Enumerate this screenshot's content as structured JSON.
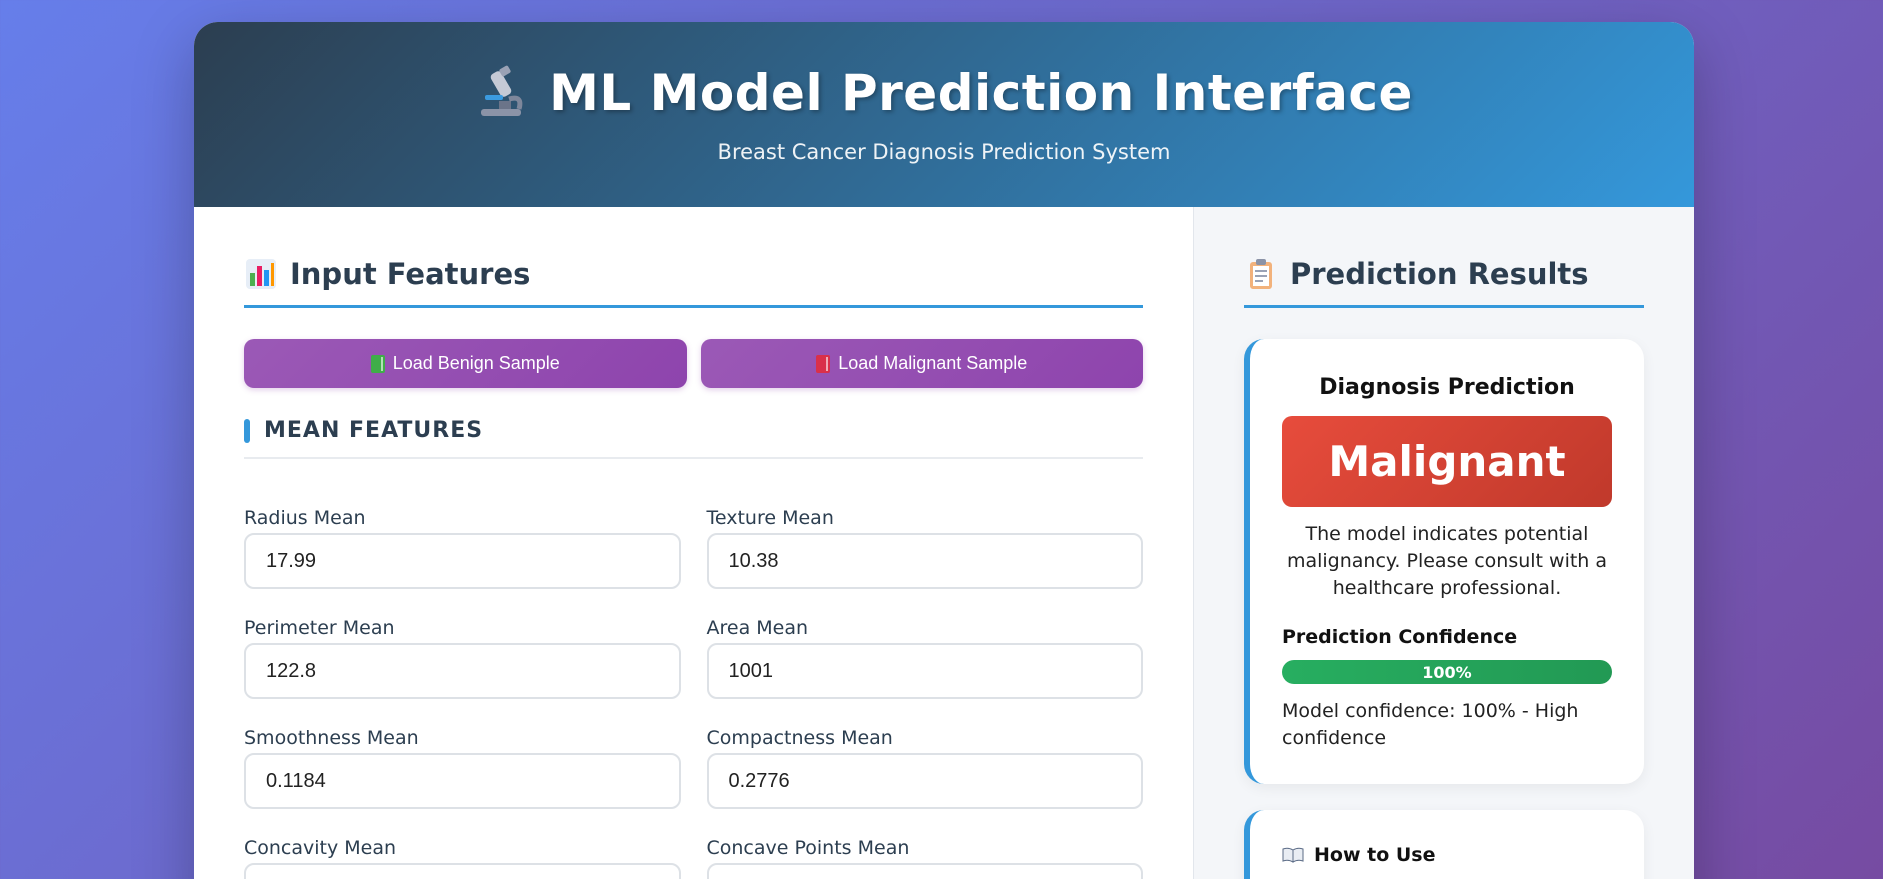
{
  "header": {
    "title": "ML Model Prediction Interface",
    "subtitle": "Breast Cancer Diagnosis Prediction System",
    "icon": "microscope-icon"
  },
  "input_panel": {
    "title": "Input Features",
    "icon": "bar-chart-icon",
    "buttons": {
      "benign": {
        "label": "Load Benign Sample",
        "icon": "green-book-icon"
      },
      "malignant": {
        "label": "Load Malignant Sample",
        "icon": "red-book-icon"
      }
    },
    "group_title": "MEAN FEATURES",
    "fields": [
      {
        "label": "Radius Mean",
        "value": "17.99"
      },
      {
        "label": "Texture Mean",
        "value": "10.38"
      },
      {
        "label": "Perimeter Mean",
        "value": "122.8"
      },
      {
        "label": "Area Mean",
        "value": "1001"
      },
      {
        "label": "Smoothness Mean",
        "value": "0.1184"
      },
      {
        "label": "Compactness Mean",
        "value": "0.2776"
      },
      {
        "label": "Concavity Mean",
        "value": ""
      },
      {
        "label": "Concave Points Mean",
        "value": ""
      }
    ]
  },
  "results_panel": {
    "title": "Prediction Results",
    "icon": "clipboard-icon",
    "diagnosis_title": "Diagnosis Prediction",
    "prediction": "Malignant",
    "prediction_color": "#e74c3c",
    "description": "The model indicates potential malignancy. Please consult with a healthcare professional.",
    "confidence_label": "Prediction Confidence",
    "confidence_value": "100%",
    "confidence_fraction": 1.0,
    "confidence_text": "Model confidence: 100% - High confidence",
    "how_to_title": "How to Use",
    "how_to_icon": "open-book-icon"
  },
  "colors": {
    "accent": "#3498db",
    "button": "#9b59b6",
    "malignant": "#e74c3c",
    "confidence": "#27ae60"
  }
}
